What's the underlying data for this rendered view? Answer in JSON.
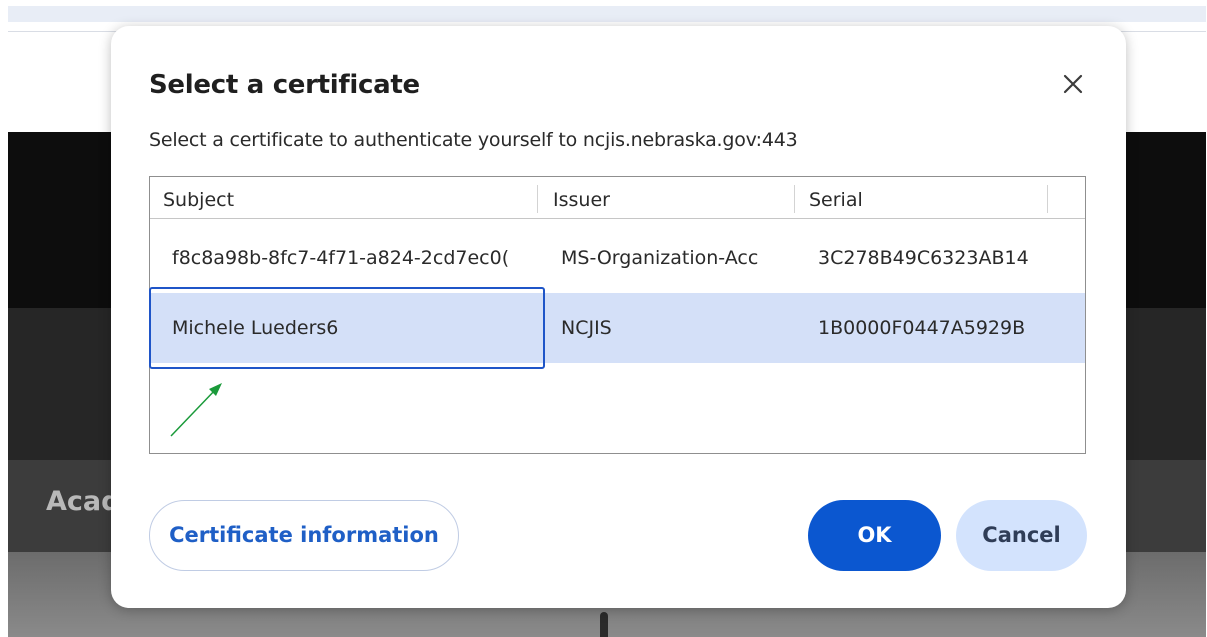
{
  "background": {
    "nav_text": "Acad"
  },
  "dialog": {
    "title": "Select a certificate",
    "description": "Select a certificate to authenticate yourself to ncjis.nebraska.gov:443",
    "close_icon": "close-icon",
    "table": {
      "columns": [
        "Subject",
        "Issuer",
        "Serial"
      ],
      "rows": [
        {
          "subject": "f8c8a98b-8fc7-4f71-a824-2cd7ec0(",
          "issuer": "MS-Organization-Acc",
          "serial": "3C278B49C6323AB14",
          "selected": false
        },
        {
          "subject": "Michele Lueders6",
          "issuer": "NCJIS",
          "serial": "1B0000F0447A5929B",
          "selected": true
        }
      ]
    },
    "buttons": {
      "certificate_information": "Certificate information",
      "ok": "OK",
      "cancel": "Cancel"
    }
  },
  "colors": {
    "accent": "#0b57d0",
    "selected_row": "#d4e0f8",
    "cancel_bg": "#d3e3fd",
    "annotation_arrow": "#1a9a3a"
  }
}
